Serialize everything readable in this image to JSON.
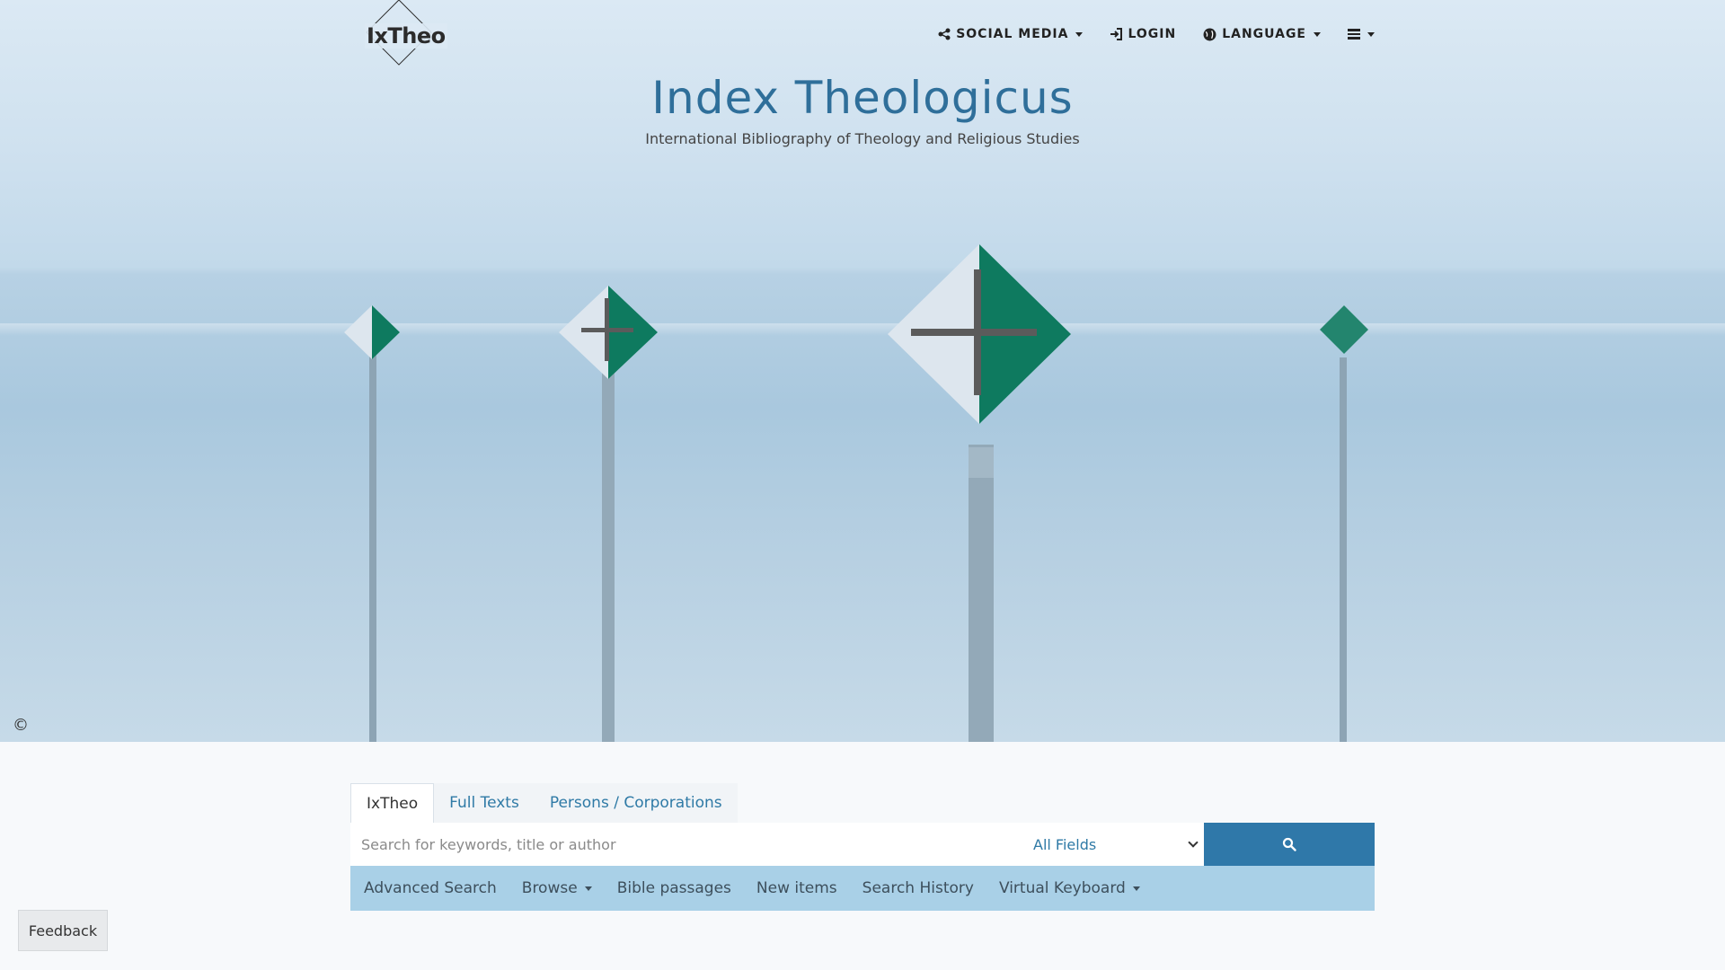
{
  "header": {
    "logo_text": "IxTheo",
    "nav": {
      "social_media": "SOCIAL MEDIA",
      "login": "LOGIN",
      "language": "LANGUAGE"
    }
  },
  "hero": {
    "title": "Index Theologicus",
    "subtitle": "International Bibliography of Theology and Religious Studies",
    "copyright_symbol": "©"
  },
  "search": {
    "tabs": [
      {
        "label": "IxTheo",
        "active": true
      },
      {
        "label": "Full Texts",
        "active": false
      },
      {
        "label": "Persons / Corporations",
        "active": false
      }
    ],
    "placeholder": "Search for keywords, title or author",
    "field_select": "All Fields",
    "links": {
      "advanced": "Advanced Search",
      "browse": "Browse",
      "bible": "Bible passages",
      "new_items": "New items",
      "history": "Search History",
      "keyboard": "Virtual Keyboard"
    }
  },
  "feedback_label": "Feedback",
  "icons": [
    "share-icon",
    "login-icon",
    "globe-icon",
    "menu-icon",
    "search-icon"
  ],
  "colors": {
    "accent": "#2f78a9",
    "title": "#2f6f9a",
    "subnav_bg": "#a9d0e7",
    "sign_green": "#0e7a5f"
  }
}
